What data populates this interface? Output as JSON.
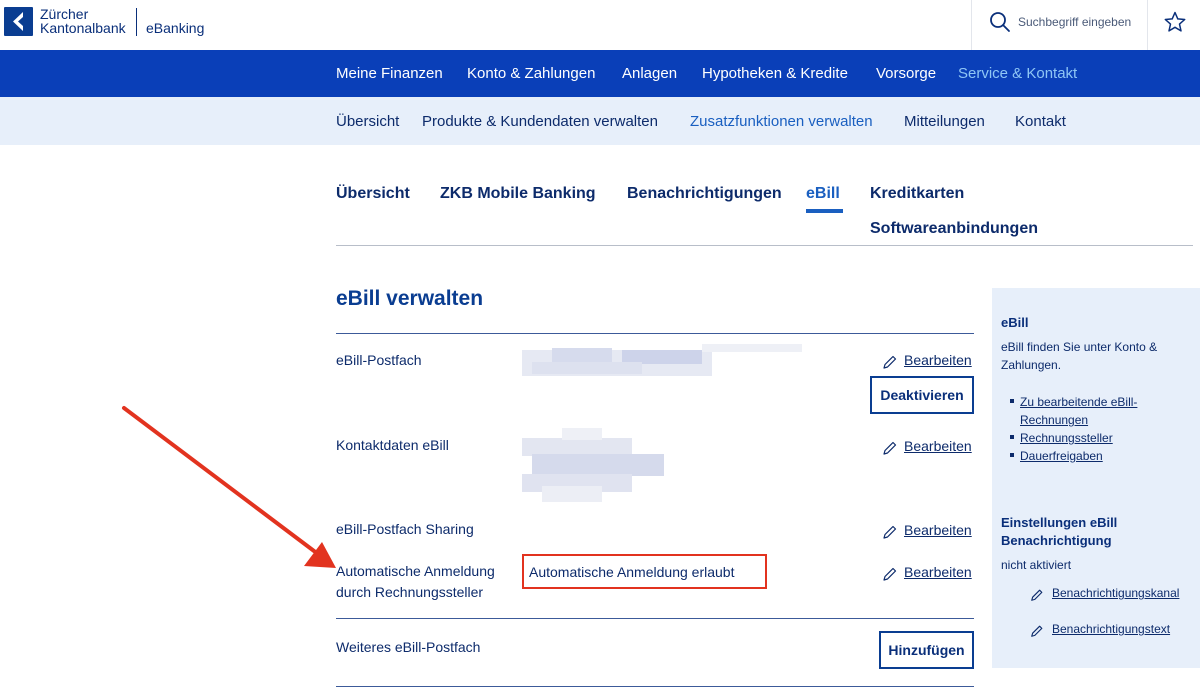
{
  "header": {
    "logo_line1": "Zürcher",
    "logo_line2": "Kantonalbank",
    "product": "eBanking",
    "search_placeholder": "Suchbegriff eingeben"
  },
  "main_nav": {
    "items": [
      "Meine Finanzen",
      "Konto & Zahlungen",
      "Anlagen",
      "Hypotheken & Kredite",
      "Vorsorge",
      "Service & Kontakt"
    ],
    "active_index": 5
  },
  "sub_nav": {
    "items": [
      "Übersicht",
      "Produkte & Kundendaten verwalten",
      "Zusatzfunktionen verwalten",
      "Mitteilungen",
      "Kontakt"
    ],
    "active_index": 2
  },
  "tabs": {
    "items": [
      "Übersicht",
      "ZKB Mobile Banking",
      "Benachrichtigungen",
      "eBill",
      "Kreditkarten",
      "Softwareanbindungen"
    ],
    "active_index": 3
  },
  "content": {
    "title": "eBill verwalten",
    "edit_label": "Bearbeiten",
    "rows": [
      {
        "label": "eBill-Postfach"
      },
      {
        "label": "Kontaktdaten eBill"
      },
      {
        "label": "eBill-Postfach Sharing"
      },
      {
        "label_line1": "Automatische Anmeldung",
        "label_line2": "durch Rechnungssteller",
        "value": "Automatische Anmeldung erlaubt"
      },
      {
        "label": "Weiteres eBill-Postfach"
      }
    ],
    "deactivate_button": "Deaktivieren",
    "add_button": "Hinzufügen"
  },
  "sidebar": {
    "ebill_title": "eBill",
    "ebill_text_line1": "eBill finden Sie unter Konto &",
    "ebill_text_line2": "Zahlungen.",
    "links": [
      {
        "line1": "Zu bearbeitende eBill-",
        "line2": "Rechnungen"
      },
      {
        "line1": "Rechnungssteller"
      },
      {
        "line1": "Dauerfreigaben"
      }
    ],
    "notify_title_line1": "Einstellungen eBill",
    "notify_title_line2": "Benachrichtigung",
    "notify_status": "nicht aktiviert",
    "notify_links": [
      "Benachrichtigungskanal",
      "Benachrichtigungstext"
    ]
  },
  "colors": {
    "brand_blue": "#0a3fb8",
    "highlight_red": "#e2331f"
  }
}
